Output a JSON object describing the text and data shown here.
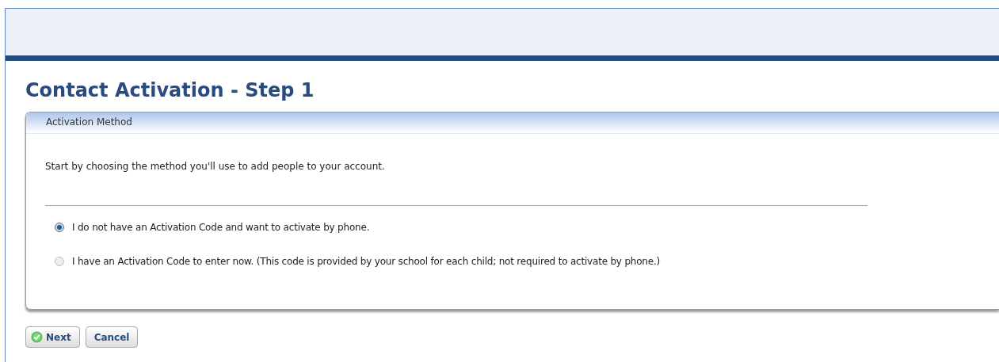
{
  "page_title": "Contact Activation - Step 1",
  "panel": {
    "title": "Activation Method",
    "intro": "Start by choosing the method you'll use to add people to your account.",
    "options": [
      {
        "label": "I do not have an Activation Code and want to activate by phone.",
        "selected": true
      },
      {
        "label": "I have an Activation Code to enter now. (This code is provided by your school for each child; not required to activate by phone.)",
        "selected": false
      }
    ]
  },
  "buttons": [
    {
      "label": "Next",
      "kind": "primary"
    },
    {
      "label": "Cancel",
      "kind": "plain"
    }
  ]
}
